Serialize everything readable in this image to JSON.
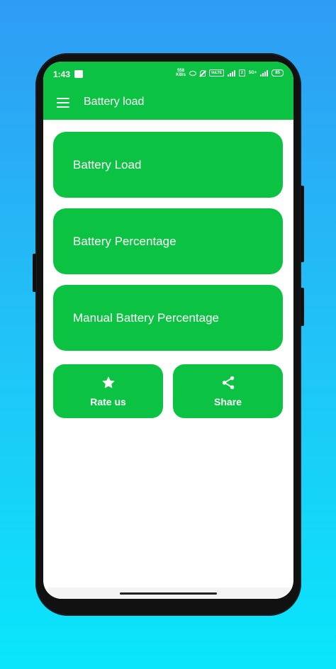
{
  "status_bar": {
    "time": "1:43",
    "net_speed_value": "558",
    "net_speed_unit": "KB/s",
    "volte": "VoLTE",
    "network": "5G+",
    "sim_indicator": "2",
    "battery_level": "85"
  },
  "app_bar": {
    "title": "Battery load",
    "menu_icon": "hamburger-menu-icon"
  },
  "menu": {
    "battery_load": "Battery Load",
    "battery_percentage": "Battery Percentage",
    "manual_battery_percentage": "Manual Battery Percentage"
  },
  "actions": {
    "rate_us": "Rate us",
    "rate_icon": "star-icon",
    "share": "Share",
    "share_icon": "share-icon"
  },
  "colors": {
    "primary_green": "#0cc243",
    "background_top": "#2f9cf4",
    "background_bottom": "#09e6fb"
  }
}
